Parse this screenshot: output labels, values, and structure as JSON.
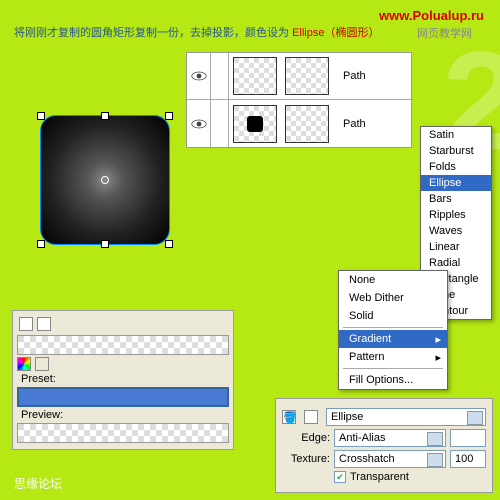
{
  "instruction": {
    "pre": "将刚刚才复制的圆角矩形复制一份，去掉投影，颜色设为 ",
    "red": "Ellipse（椭圆形）"
  },
  "watermark1": "www.Polualup.ru",
  "watermark2": "网页教学网",
  "forum": "思缘论坛",
  "layers": [
    {
      "name": "Path"
    },
    {
      "name": "Path"
    }
  ],
  "gradientMenu": {
    "items": [
      "Satin",
      "Starburst",
      "Folds",
      "Ellipse",
      "Bars",
      "Ripples",
      "Waves",
      "Linear",
      "Radial",
      "Rectangle",
      "Cone",
      "Contour"
    ],
    "selected": "Ellipse"
  },
  "fillMenu": {
    "none": "None",
    "webDither": "Web Dither",
    "solid": "Solid",
    "gradient": "Gradient",
    "pattern": "Pattern",
    "fillOptions": "Fill Options...",
    "selected": "Gradient"
  },
  "stylePanel": {
    "preset": "Preset:",
    "preview": "Preview:"
  },
  "propPanel": {
    "fillType": "Ellipse",
    "edgeLabel": "Edge:",
    "edgeValue": "Anti-Alias",
    "textureLabel": "Texture:",
    "textureValue": "Crosshatch",
    "textureAmount": "100",
    "transparent": "Transparent",
    "transparentChecked": true
  }
}
